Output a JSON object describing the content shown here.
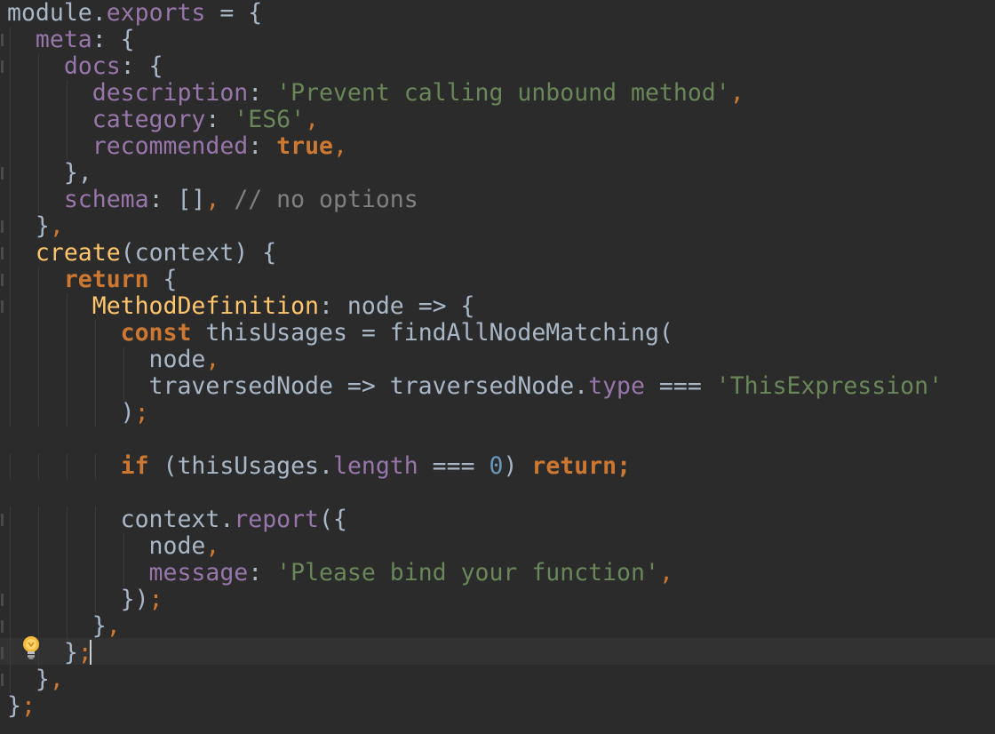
{
  "colors": {
    "background": "#2b2b2b",
    "caret_line": "#323232",
    "default_text": "#a9b7c6",
    "keyword": "#cc7832",
    "property": "#9876aa",
    "string": "#6a8759",
    "comment": "#808080",
    "number": "#6897bb",
    "function": "#ffc66d"
  },
  "icons": {
    "intention_bulb": "lightbulb-icon"
  },
  "lines": [
    [
      [
        "module",
        "default"
      ],
      [
        ".",
        "default"
      ],
      [
        "exports",
        "prop"
      ],
      [
        " = {",
        "default"
      ]
    ],
    [
      [
        "  ",
        "default"
      ],
      [
        "meta",
        "prop"
      ],
      [
        ": {",
        "default"
      ]
    ],
    [
      [
        "    ",
        "default"
      ],
      [
        "docs",
        "prop"
      ],
      [
        ": {",
        "default"
      ]
    ],
    [
      [
        "      ",
        "default"
      ],
      [
        "description",
        "prop"
      ],
      [
        ": ",
        "default"
      ],
      [
        "'Prevent calling unbound method'",
        "string"
      ],
      [
        ",",
        "punct"
      ]
    ],
    [
      [
        "      ",
        "default"
      ],
      [
        "category",
        "prop"
      ],
      [
        ": ",
        "default"
      ],
      [
        "'ES6'",
        "string"
      ],
      [
        ",",
        "punct"
      ]
    ],
    [
      [
        "      ",
        "default"
      ],
      [
        "recommended",
        "prop"
      ],
      [
        ": ",
        "default"
      ],
      [
        "true",
        "keyword"
      ],
      [
        ",",
        "punct"
      ]
    ],
    [
      [
        "    },",
        "default"
      ]
    ],
    [
      [
        "    ",
        "default"
      ],
      [
        "schema",
        "prop"
      ],
      [
        ": []",
        "default"
      ],
      [
        ",",
        "punct"
      ],
      [
        " // no options",
        "comment"
      ]
    ],
    [
      [
        "  }",
        "default"
      ],
      [
        ",",
        "punct"
      ]
    ],
    [
      [
        "  ",
        "default"
      ],
      [
        "create",
        "func"
      ],
      [
        "(context) {",
        "default"
      ]
    ],
    [
      [
        "    ",
        "default"
      ],
      [
        "return",
        "keyword"
      ],
      [
        " {",
        "default"
      ]
    ],
    [
      [
        "      ",
        "default"
      ],
      [
        "MethodDefinition",
        "func"
      ],
      [
        ": node => {",
        "default"
      ]
    ],
    [
      [
        "        ",
        "default"
      ],
      [
        "const",
        "keyword"
      ],
      [
        " thisUsages = findAllNodeMatching(",
        "default"
      ]
    ],
    [
      [
        "          node",
        "default"
      ],
      [
        ",",
        "punct"
      ]
    ],
    [
      [
        "          traversedNode => traversedNode.",
        "default"
      ],
      [
        "type",
        "prop"
      ],
      [
        " === ",
        "default"
      ],
      [
        "'ThisExpression'",
        "string"
      ]
    ],
    [
      [
        "        )",
        "default"
      ],
      [
        ";",
        "punct"
      ]
    ],
    [
      [
        "",
        "default"
      ]
    ],
    [
      [
        "        ",
        "default"
      ],
      [
        "if",
        "keyword"
      ],
      [
        " (thisUsages.",
        "default"
      ],
      [
        "length",
        "prop"
      ],
      [
        " === ",
        "default"
      ],
      [
        "0",
        "number"
      ],
      [
        ") ",
        "default"
      ],
      [
        "return;",
        "keyword"
      ]
    ],
    [
      [
        "",
        "default"
      ]
    ],
    [
      [
        "        context.",
        "default"
      ],
      [
        "report",
        "prop"
      ],
      [
        "({",
        "default"
      ]
    ],
    [
      [
        "          node",
        "default"
      ],
      [
        ",",
        "punct"
      ]
    ],
    [
      [
        "          ",
        "default"
      ],
      [
        "message",
        "prop"
      ],
      [
        ": ",
        "default"
      ],
      [
        "'Please bind your function'",
        "string"
      ],
      [
        ",",
        "punct"
      ]
    ],
    [
      [
        "        })",
        "default"
      ],
      [
        ";",
        "punct"
      ]
    ],
    [
      [
        "      }",
        "default"
      ],
      [
        ",",
        "punct"
      ]
    ],
    [
      [
        "    }",
        "default"
      ],
      [
        ";",
        "punct"
      ]
    ],
    [
      [
        "  }",
        "default"
      ],
      [
        ",",
        "punct"
      ]
    ],
    [
      [
        "}",
        "default"
      ],
      [
        ";",
        "punct"
      ]
    ]
  ]
}
